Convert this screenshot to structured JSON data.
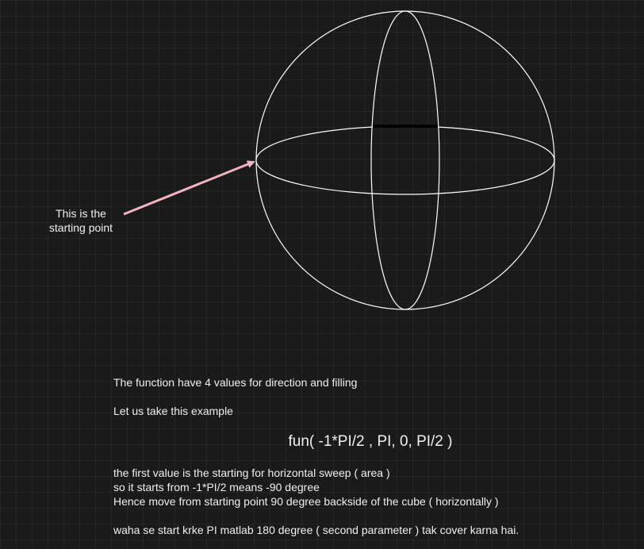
{
  "diagram": {
    "annotation": {
      "line1": "This is the",
      "line2": "starting point",
      "arrow_color": "#f4b3c0"
    },
    "stroke_color": "#ffffff",
    "emphasis_color": "#000000"
  },
  "notes": {
    "intro": "The function have 4 values for direction and filling",
    "example_intro": "Let us take this example",
    "formula": "fun( -1*PI/2 , PI, 0, PI/2 )",
    "explanation": [
      "the first value is the starting for horizontal sweep ( area )",
      "so it starts from -1*PI/2 means -90 degree",
      "Hence move from starting point 90 degree backside of the cube ( horizontally )",
      "waha se start krke PI matlab 180 degree ( second parameter ) tak cover karna hai."
    ]
  }
}
